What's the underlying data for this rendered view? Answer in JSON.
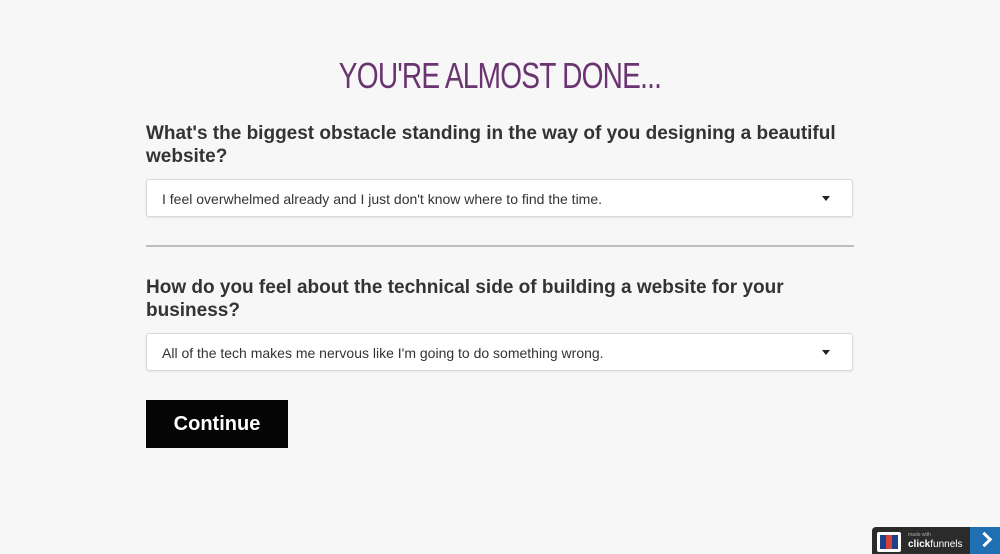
{
  "headline": "YOU'RE ALMOST DONE...",
  "questions": [
    {
      "label": "What's the biggest obstacle standing in the way of you designing a beautiful website?",
      "selected": "I feel overwhelmed already and I just don't know where to find the time."
    },
    {
      "label": "How do you feel about the technical side of building a website for your business?",
      "selected": "All of the tech makes me nervous like I'm going to do something wrong."
    }
  ],
  "continue_label": "Continue",
  "badge": {
    "made_with": "made with",
    "brand_prefix": "click",
    "brand_suffix": "funnels"
  },
  "colors": {
    "headline": "#6a3470",
    "button_bg": "#050505",
    "page_bg": "#f7f7f7"
  },
  "icons": [
    "dropdown-caret-icon",
    "clickfunnels-logo-icon",
    "chevron-right-icon"
  ]
}
